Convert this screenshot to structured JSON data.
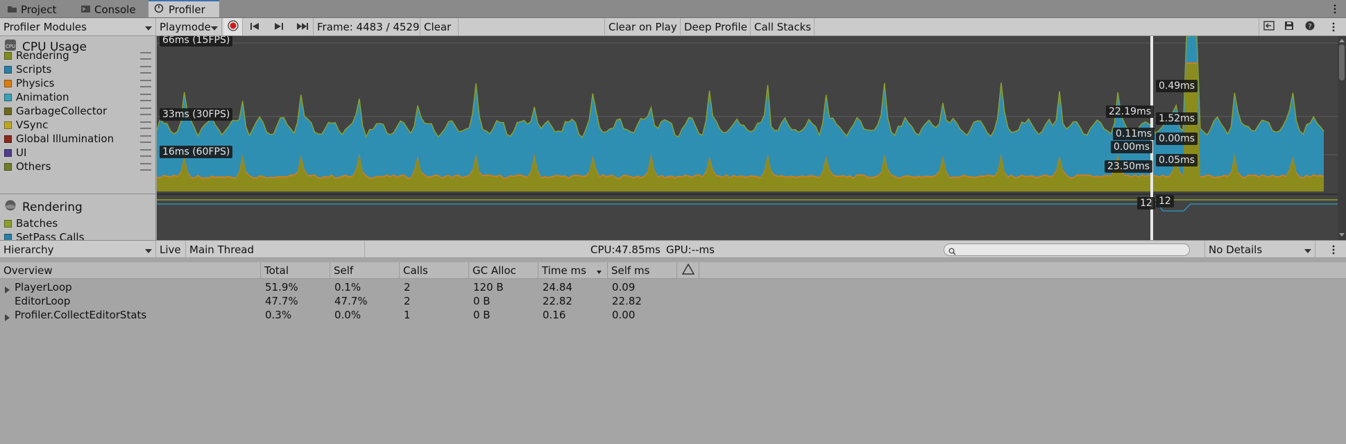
{
  "tabs": [
    {
      "label": "Project",
      "icon": "folder-icon"
    },
    {
      "label": "Console",
      "icon": "console-icon"
    },
    {
      "label": "Profiler",
      "icon": "profiler-icon",
      "active": true
    }
  ],
  "toolbar": {
    "modules_dropdown": "Profiler Modules",
    "target_dropdown": "Playmode",
    "frame_label": "Frame: 4483 / 4529",
    "clear": "Clear",
    "clear_on_play": "Clear on Play",
    "deep_profile": "Deep Profile",
    "call_stacks": "Call Stacks"
  },
  "modules": {
    "cpu": {
      "title": "CPU Usage",
      "legend": [
        {
          "label": "Rendering",
          "color": "#7f8e1e"
        },
        {
          "label": "Scripts",
          "color": "#2b7fa5"
        },
        {
          "label": "Physics",
          "color": "#d97f12"
        },
        {
          "label": "Animation",
          "color": "#3aa1b5"
        },
        {
          "label": "GarbageCollector",
          "color": "#6b6b1f"
        },
        {
          "label": "VSync",
          "color": "#bca722"
        },
        {
          "label": "Global Illumination",
          "color": "#8a2a1c"
        },
        {
          "label": "UI",
          "color": "#4d3d8a"
        },
        {
          "label": "Others",
          "color": "#6f7e28"
        }
      ]
    },
    "rendering": {
      "title": "Rendering",
      "legend": [
        {
          "label": "Batches",
          "color": "#8aa12c"
        },
        {
          "label": "SetPass Calls",
          "color": "#2b7fa5"
        }
      ]
    }
  },
  "chart": {
    "grid_labels": [
      "66ms (15FPS)",
      "33ms (30FPS)",
      "16ms (60FPS)"
    ],
    "selected_left": [
      "22.19ms",
      "0.11ms",
      "0.00ms",
      "23.50ms"
    ],
    "selected_right": [
      "0.49ms",
      "1.52ms",
      "0.00ms",
      "0.05ms"
    ],
    "render_left": "12",
    "render_right": "12"
  },
  "hierarchy_toolbar": {
    "view": "Hierarchy",
    "live": "Live",
    "thread": "Main Thread",
    "cpu": "CPU:47.85ms",
    "gpu": "GPU:--ms",
    "search_placeholder": "",
    "details": "No Details"
  },
  "table": {
    "columns": [
      "Overview",
      "Total",
      "Self",
      "Calls",
      "GC Alloc",
      "Time ms",
      "Self ms"
    ],
    "rows": [
      {
        "name": "PlayerLoop",
        "expandable": true,
        "total": "51.9%",
        "self": "0.1%",
        "calls": "2",
        "gc": "120 B",
        "time": "24.84",
        "selfms": "0.09"
      },
      {
        "name": "EditorLoop",
        "expandable": false,
        "total": "47.7%",
        "self": "47.7%",
        "calls": "2",
        "gc": "0 B",
        "time": "22.82",
        "selfms": "22.82"
      },
      {
        "name": "Profiler.CollectEditorStats",
        "expandable": true,
        "total": "0.3%",
        "self": "0.0%",
        "calls": "1",
        "gc": "0 B",
        "time": "0.16",
        "selfms": "0.00"
      }
    ]
  }
}
